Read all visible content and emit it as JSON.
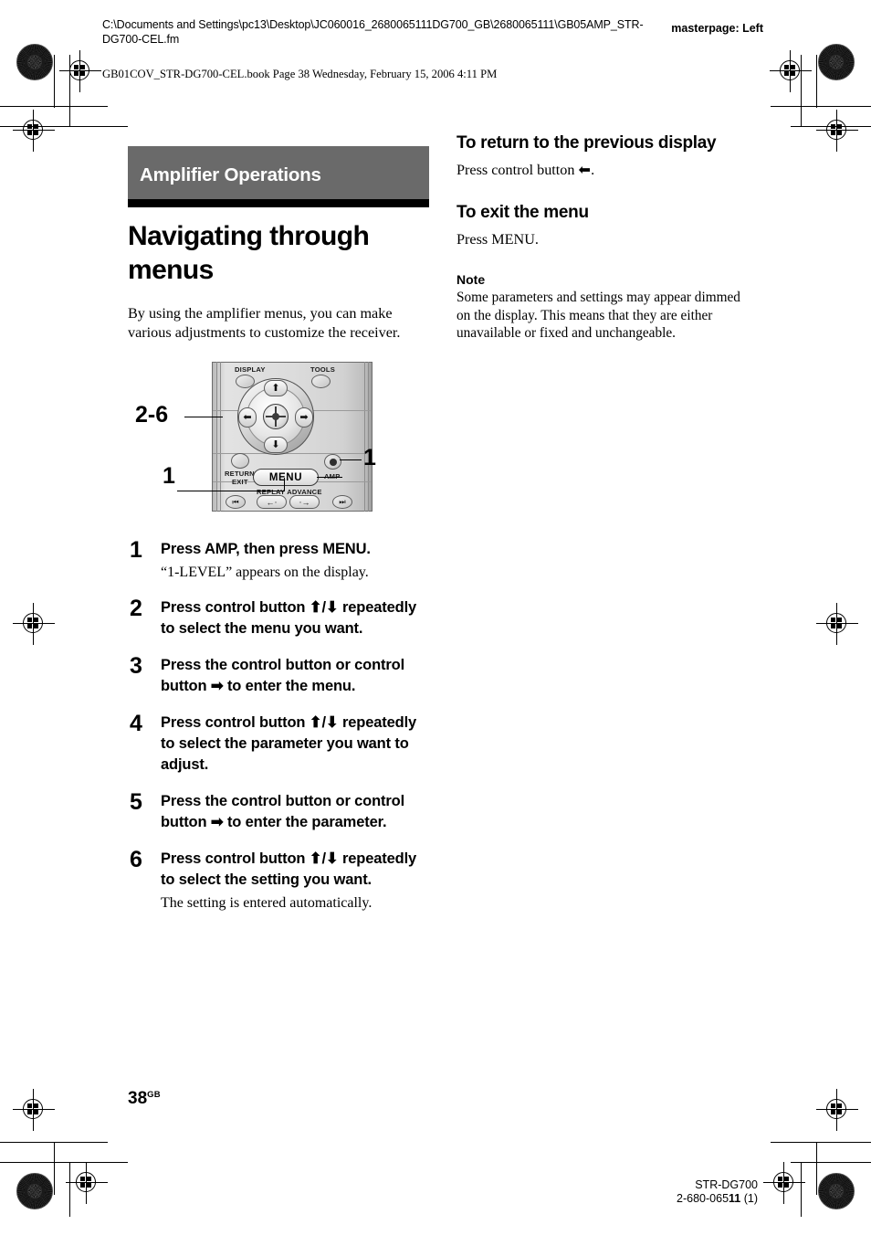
{
  "header": {
    "filepath": "C:\\Documents and Settings\\pc13\\Desktop\\JC060016_2680065111DG700_GB\\2680065111\\GB05AMP_STR-DG700-CEL.fm",
    "masterpage": "masterpage: Left",
    "bookline": "GB01COV_STR-DG700-CEL.book  Page 38  Wednesday, February 15, 2006  4:11 PM"
  },
  "left_column": {
    "chapter": "Amplifier Operations",
    "title": "Navigating through menus",
    "intro": "By using the amplifier menus, you can make various adjustments to customize the receiver.",
    "figure": {
      "callout_top": "2-6",
      "callout_right": "1",
      "callout_bottom": "1",
      "labels": {
        "display": "DISPLAY",
        "tools": "TOOLS",
        "return_exit_line1": "RETURN/",
        "return_exit_line2": "EXIT",
        "menu": "MENU",
        "amp": "AMP",
        "replay_advance": "REPLAY ADVANCE",
        "up_arrow": "⬆",
        "down_arrow": "⬇",
        "left_arrow": "⬅",
        "right_arrow": "➡",
        "prev_track": "⏮",
        "next_track": "⏭",
        "replay": "←·",
        "advance": "·→"
      }
    },
    "steps": [
      {
        "num": "1",
        "title": "Press AMP, then press MENU.",
        "note": "“1-LEVEL” appears on the display."
      },
      {
        "num": "2",
        "title": "Press control button ⬆/⬇ repeatedly to select the menu you want.",
        "note": ""
      },
      {
        "num": "3",
        "title": "Press the control button or control button ➡ to enter the menu.",
        "note": ""
      },
      {
        "num": "4",
        "title": "Press control button ⬆/⬇ repeatedly to select the parameter you want to adjust.",
        "note": ""
      },
      {
        "num": "5",
        "title": "Press the control button or control button ➡ to enter the parameter.",
        "note": ""
      },
      {
        "num": "6",
        "title": "Press control button ⬆/⬇ repeatedly to select the setting you want.",
        "note": "The setting is entered automatically."
      }
    ]
  },
  "right_column": {
    "section1_head": "To return to the previous display",
    "section1_body": "Press control button ⬅.",
    "section2_head": "To exit the menu",
    "section2_body": "Press MENU.",
    "note_head": "Note",
    "note_body": "Some parameters and settings may appear dimmed on the display. This means that they are either unavailable or fixed and unchangeable."
  },
  "footer": {
    "page_number": "38",
    "page_suffix": "GB",
    "model": "STR-DG700",
    "doc_number_prefix": "2-680-065",
    "doc_number_bold": "11",
    "doc_number_suffix": " (1)"
  },
  "colors": {
    "chapter_bar": "#6a6a6a",
    "chapter_rule": "#000000",
    "page_bg": "#ffffff"
  }
}
